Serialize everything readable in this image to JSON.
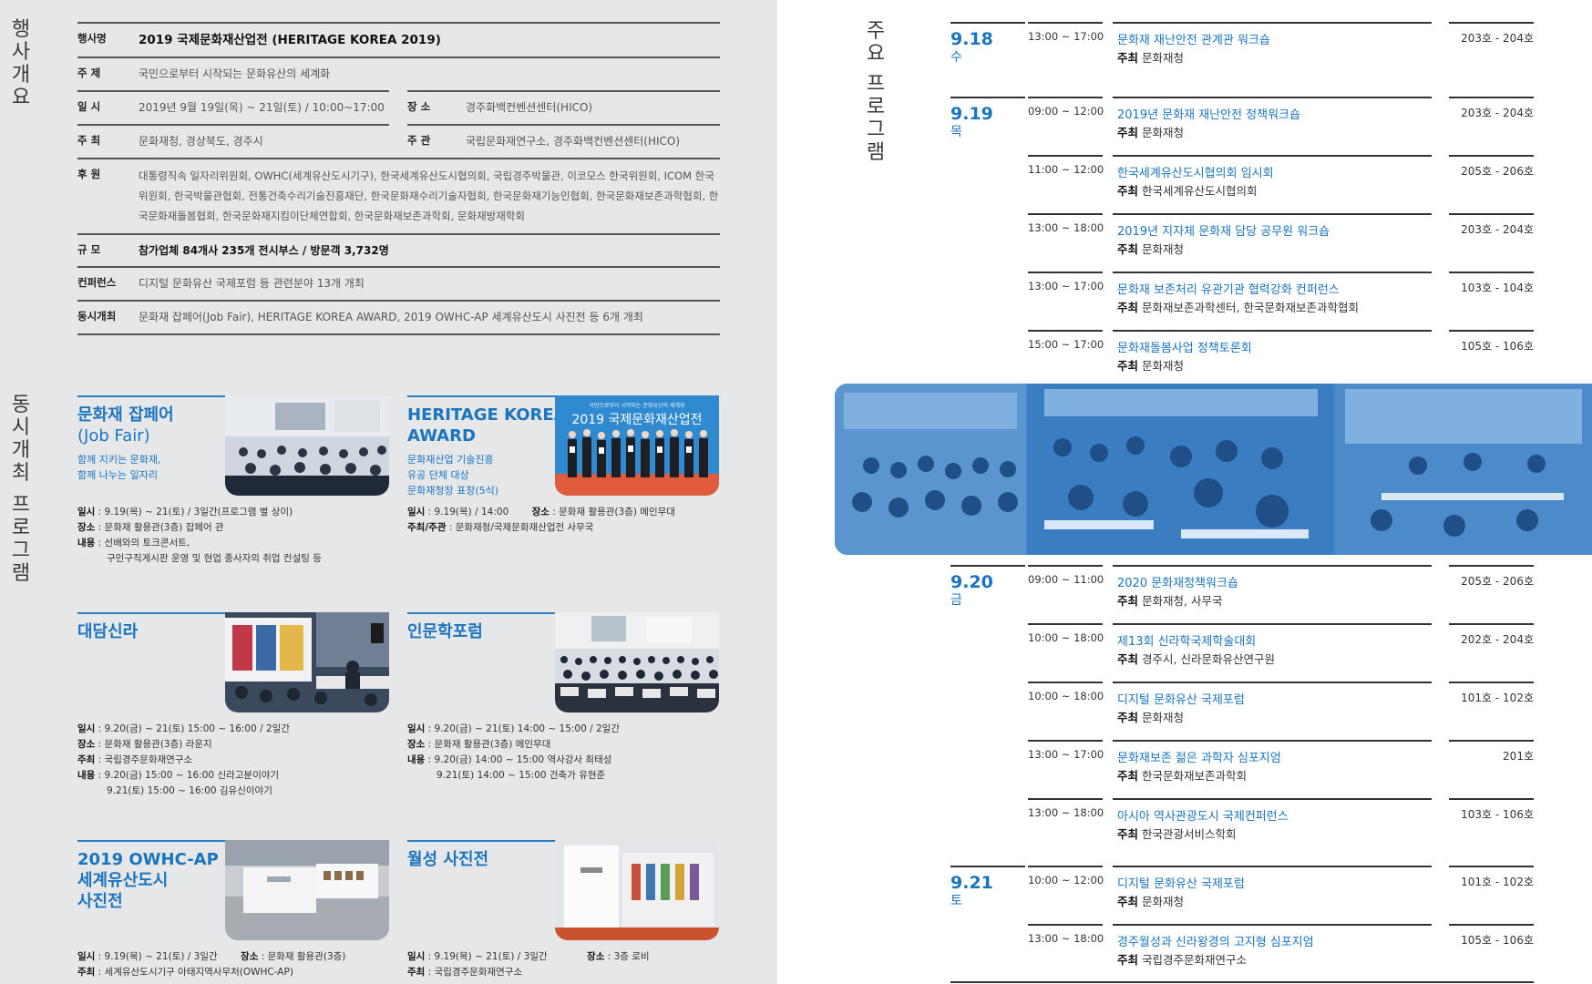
{
  "left": {
    "section1_title": [
      "행",
      "사",
      "개",
      "요"
    ],
    "section2_title": [
      "동",
      "시",
      "개",
      "최",
      "",
      "프",
      "로",
      "그",
      "램"
    ],
    "info": {
      "event": {
        "label": "행사명",
        "value": "2019 국제문화재산업전 (HERITAGE KOREA 2019)"
      },
      "theme": {
        "label": "주 제",
        "value": "국민으로부터 시작되는 문화유산의 세계화"
      },
      "date": {
        "label": "일 시",
        "value": "2019년 9월 19일(목) ~ 21일(토) / 10:00~17:00"
      },
      "venue": {
        "label": "장 소",
        "value": "경주화백컨벤션센터(HICO)"
      },
      "organizer": {
        "label": "주 최",
        "value": "문화재청, 경상북도, 경주시"
      },
      "host": {
        "label": "주 관",
        "value": "국립문화재연구소, 경주화백컨벤션센터(HICO)"
      },
      "sponsor": {
        "label": "후 원",
        "value": "대통령직속 일자리위원회, OWHC(세계유산도시기구), 한국세계유산도시협의회, 국립경주박물관, 이코모스 한국위원회, ICOM 한국위원회, 한국박물관협회, 전통건축수리기술진흥재단, 한국문화재수리기술자협회, 한국문화재기능인협회, 한국문화재보존과학협회, 한국문화재돌봄협회, 한국문화재지킴이단체연합회, 한국문화재보존과학회, 문화재방재학회"
      },
      "scale": {
        "label": "규 모",
        "value": "참가업체 84개사 235개 전시부스 / 방문객 3,732명"
      },
      "conference": {
        "label": "컨퍼런스",
        "value": "디지털 문화유산 국제포럼 등 관련분야 13개 개최"
      },
      "concurrent": {
        "label": "동시개최",
        "value": "문화재 잡페어(Job Fair), HERITAGE KOREA AWARD, 2019 OWHC-AP 세계유산도시 사진전 등 6개 개최"
      }
    },
    "programs": {
      "jobfair": {
        "title1": "문화재 잡페어",
        "title2": "(Job Fair)",
        "sub": [
          "함께 지키는 문화재,",
          "함께 나누는 일자리"
        ],
        "lines": [
          {
            "k": "일시",
            "v": " : 9.19(목) ~ 21(토) / 3일간(프로그램 별 상이)"
          },
          {
            "k": "장소",
            "v": " : 문화재 활용관(3층) 잡페어 관"
          },
          {
            "k": "내용",
            "v": " : 선배와의 토크콘서트,"
          },
          {
            "k": "",
            "v": "구인구직게시판 운영 및 현업 종사자의 취업 컨설팅 등"
          }
        ]
      },
      "award": {
        "title1": "HERITAGE KOREA",
        "title2": "AWARD",
        "sub": [
          "문화재산업 기술진흥",
          "유공 단체 대상",
          "문화재청장 표창(5식)"
        ],
        "banner": "2019 국제문화재산업전",
        "banner_small": "국민으로부터 시작되는 문화유산의 세계화",
        "lines": [
          {
            "k": "일시",
            "v": " : 9.19(목) / 14:00",
            "k2": "장소",
            "v2": " : 문화재 활용관(3층) 메인무대"
          },
          {
            "k": "주최/주관",
            "v": " : 문화재청/국제문화재산업전 사무국"
          }
        ]
      },
      "silla": {
        "title1": "대담신라",
        "lines": [
          {
            "k": "일시",
            "v": " : 9.20(금) ~ 21(토) 15:00 ~ 16:00 / 2일간"
          },
          {
            "k": "장소",
            "v": " : 문화재 활용관(3층) 라운지"
          },
          {
            "k": "주최",
            "v": " : 국립경주문화재연구소"
          },
          {
            "k": "내용",
            "v": " : 9.20(금) 15:00 ~ 16:00 신라고분이야기"
          },
          {
            "k": "",
            "v": "9.21(토) 15:00 ~ 16:00 김유신이야기"
          }
        ]
      },
      "humanities": {
        "title1": "인문학포럼",
        "lines": [
          {
            "k": "일시",
            "v": " : 9.20(금) ~ 21(토) 14:00 ~ 15:00 / 2일간"
          },
          {
            "k": "장소",
            "v": " : 문화재 활용관(3층) 메인무대"
          },
          {
            "k": "내용",
            "v": " : 9.20(금) 14:00 ~ 15:00 역사강사 최태성"
          },
          {
            "k": "",
            "v": "9.21(토) 14:00 ~ 15:00 건축가 유현준"
          }
        ]
      },
      "owhc": {
        "title1": "2019 OWHC-AP",
        "title2": "세계유산도시",
        "title3": "사진전",
        "lines": [
          {
            "k": "일시",
            "v": " : 9.19(목) ~ 21(토) / 3일간",
            "k2": "장소",
            "v2": " : 문화재 활용관(3층)"
          },
          {
            "k": "주최",
            "v": " : 세계유산도시기구 아태지역사무처(OWHC-AP)"
          }
        ]
      },
      "wolseong": {
        "title1": "월성 사진전",
        "lines": [
          {
            "k": "일시",
            "v": " : 9.19(목) ~ 21(토) / 3일간",
            "k2": "장소",
            "v2": " : 3층 로비"
          },
          {
            "k": "주최",
            "v": " : 국립경주문화재연구소"
          }
        ]
      }
    }
  },
  "right": {
    "title": [
      "주",
      "요",
      "",
      "프",
      "로",
      "그",
      "램"
    ],
    "host_label": "주최",
    "days": [
      {
        "date": "9.18",
        "dow": "수",
        "items": [
          {
            "time": "13:00 ~ 17:00",
            "name": "문화재 재난안전 관계관 워크숍",
            "host": "문화재청",
            "room": "203호 - 204호"
          }
        ]
      },
      {
        "date": "9.19",
        "dow": "목",
        "items": [
          {
            "time": "09:00 ~ 12:00",
            "name": "2019년 문화재 재난안전 정책워크숍",
            "host": "문화재청",
            "room": "203호 - 204호"
          },
          {
            "time": "11:00 ~ 12:00",
            "name": "한국세계유산도시협의회 임시회",
            "host": "한국세계유산도시협의회",
            "room": "205호 - 206호"
          },
          {
            "time": "13:00 ~ 18:00",
            "name": "2019년 지자체 문화재 담당 공무원 워크숍",
            "host": "문화재청",
            "room": "203호 - 204호"
          },
          {
            "time": "13:00 ~ 17:00",
            "name": "문화재 보존처리 유관기관 협력강화 컨퍼런스",
            "host": "문화재보존과학센터, 한국문화재보존과학협회",
            "room": "103호 - 104호"
          },
          {
            "time": "15:00 ~ 17:00",
            "name": "문화재돌봄사업 정책토론회",
            "host": "문화재청",
            "room": "105호 - 106호"
          }
        ]
      },
      {
        "date": "9.20",
        "dow": "금",
        "items": [
          {
            "time": "09:00 ~ 11:00",
            "name": "2020 문화재정책워크숍",
            "host": "문화재청, 사무국",
            "room": "205호 - 206호"
          },
          {
            "time": "10:00 ~ 18:00",
            "name": "제13회 신라학국제학술대회",
            "host": "경주시, 신라문화유산연구원",
            "room": "202호 - 204호"
          },
          {
            "time": "10:00 ~ 18:00",
            "name": "디지털 문화유산 국제포럼",
            "host": "문화재청",
            "room": "101호 - 102호"
          },
          {
            "time": "13:00 ~ 17:00",
            "name": "문화재보존 젊은 과학자 심포지엄",
            "host": "한국문화재보존과학회",
            "room": "201호"
          },
          {
            "time": "13:00 ~ 18:00",
            "name": "아시아 역사관광도시 국제컨퍼런스",
            "host": "한국관광서비스학회",
            "room": "103호 - 106호"
          }
        ]
      },
      {
        "date": "9.21",
        "dow": "토",
        "items": [
          {
            "time": "10:00 ~ 12:00",
            "name": "디지털 문화유산 국제포럼",
            "host": "문화재청",
            "room": "101호 - 102호"
          },
          {
            "time": "13:00 ~ 18:00",
            "name": "경주월성과 신라왕경의 고지형 심포지엄",
            "host": "국립경주문화재연구소",
            "room": "105호 - 106호"
          }
        ]
      }
    ]
  }
}
